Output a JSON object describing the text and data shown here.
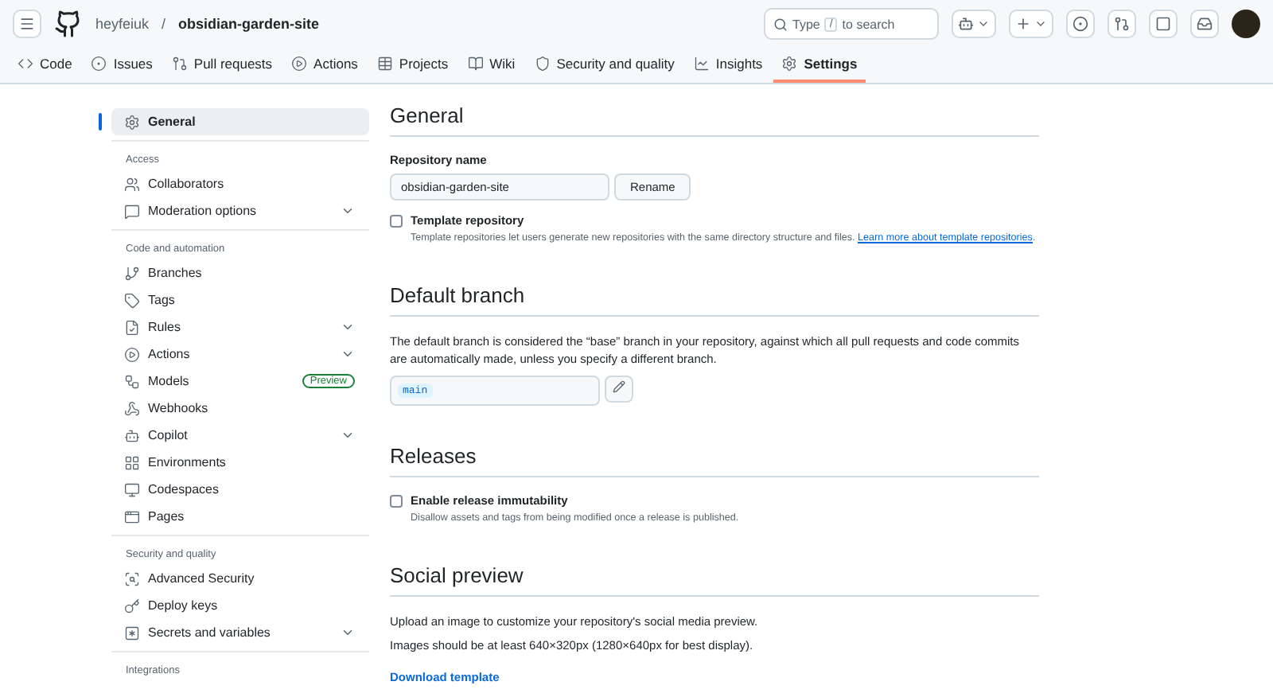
{
  "header": {
    "owner": "heyfeiuk",
    "separator": "/",
    "repo": "obsidian-garden-site",
    "search": {
      "prefix": "Type",
      "key": "/",
      "suffix": "to search"
    }
  },
  "tabs": [
    {
      "label": "Code",
      "selected": false
    },
    {
      "label": "Issues",
      "selected": false
    },
    {
      "label": "Pull requests",
      "selected": false
    },
    {
      "label": "Actions",
      "selected": false
    },
    {
      "label": "Projects",
      "selected": false
    },
    {
      "label": "Wiki",
      "selected": false
    },
    {
      "label": "Security and quality",
      "selected": false
    },
    {
      "label": "Insights",
      "selected": false
    },
    {
      "label": "Settings",
      "selected": true
    }
  ],
  "sidebar": {
    "groups": [
      {
        "items": [
          {
            "label": "General",
            "selected": true,
            "expandable": false
          }
        ]
      },
      {
        "heading": "Access",
        "items": [
          {
            "label": "Collaborators",
            "selected": false,
            "expandable": false
          },
          {
            "label": "Moderation options",
            "selected": false,
            "expandable": true
          }
        ]
      },
      {
        "heading": "Code and automation",
        "items": [
          {
            "label": "Branches",
            "selected": false,
            "expandable": false
          },
          {
            "label": "Tags",
            "selected": false,
            "expandable": false
          },
          {
            "label": "Rules",
            "selected": false,
            "expandable": true
          },
          {
            "label": "Actions",
            "selected": false,
            "expandable": true
          },
          {
            "label": "Models",
            "selected": false,
            "expandable": false,
            "badge": "Preview"
          },
          {
            "label": "Webhooks",
            "selected": false,
            "expandable": false
          },
          {
            "label": "Copilot",
            "selected": false,
            "expandable": true
          },
          {
            "label": "Environments",
            "selected": false,
            "expandable": false
          },
          {
            "label": "Codespaces",
            "selected": false,
            "expandable": false
          },
          {
            "label": "Pages",
            "selected": false,
            "expandable": false
          }
        ]
      },
      {
        "heading": "Security and quality",
        "items": [
          {
            "label": "Advanced Security",
            "selected": false,
            "expandable": false
          },
          {
            "label": "Deploy keys",
            "selected": false,
            "expandable": false
          },
          {
            "label": "Secrets and variables",
            "selected": false,
            "expandable": true
          }
        ]
      },
      {
        "heading": "Integrations"
      }
    ]
  },
  "main": {
    "sections": [
      {
        "title": "General",
        "blocks": [
          {
            "kind": "rename",
            "label": "Repository name",
            "value": "obsidian-garden-site",
            "button": "Rename"
          },
          {
            "kind": "checkbox",
            "label": "Template repository",
            "checked": false,
            "description": "Template repositories let users generate new repositories with the same directory structure and files.",
            "link": "Learn more about template repositories",
            "after": "."
          }
        ]
      },
      {
        "title": "Default branch",
        "blocks": [
          {
            "kind": "text",
            "text": "The default branch is considered the “base” branch in your repository, against which all pull requests and code commits are automatically made, unless you specify a different branch."
          },
          {
            "kind": "branch",
            "value": "main"
          }
        ]
      },
      {
        "title": "Releases",
        "blocks": [
          {
            "kind": "checkbox",
            "label": "Enable release immutability",
            "checked": false,
            "description": "Disallow assets and tags from being modified once a release is published."
          }
        ]
      },
      {
        "title": "Social preview",
        "blocks": [
          {
            "kind": "text",
            "text": "Upload an image to customize your repository's social media preview."
          },
          {
            "kind": "text",
            "text": "Images should be at least 640×320px (1280×640px for best display)."
          },
          {
            "kind": "link",
            "text": "Download template"
          }
        ]
      }
    ]
  }
}
